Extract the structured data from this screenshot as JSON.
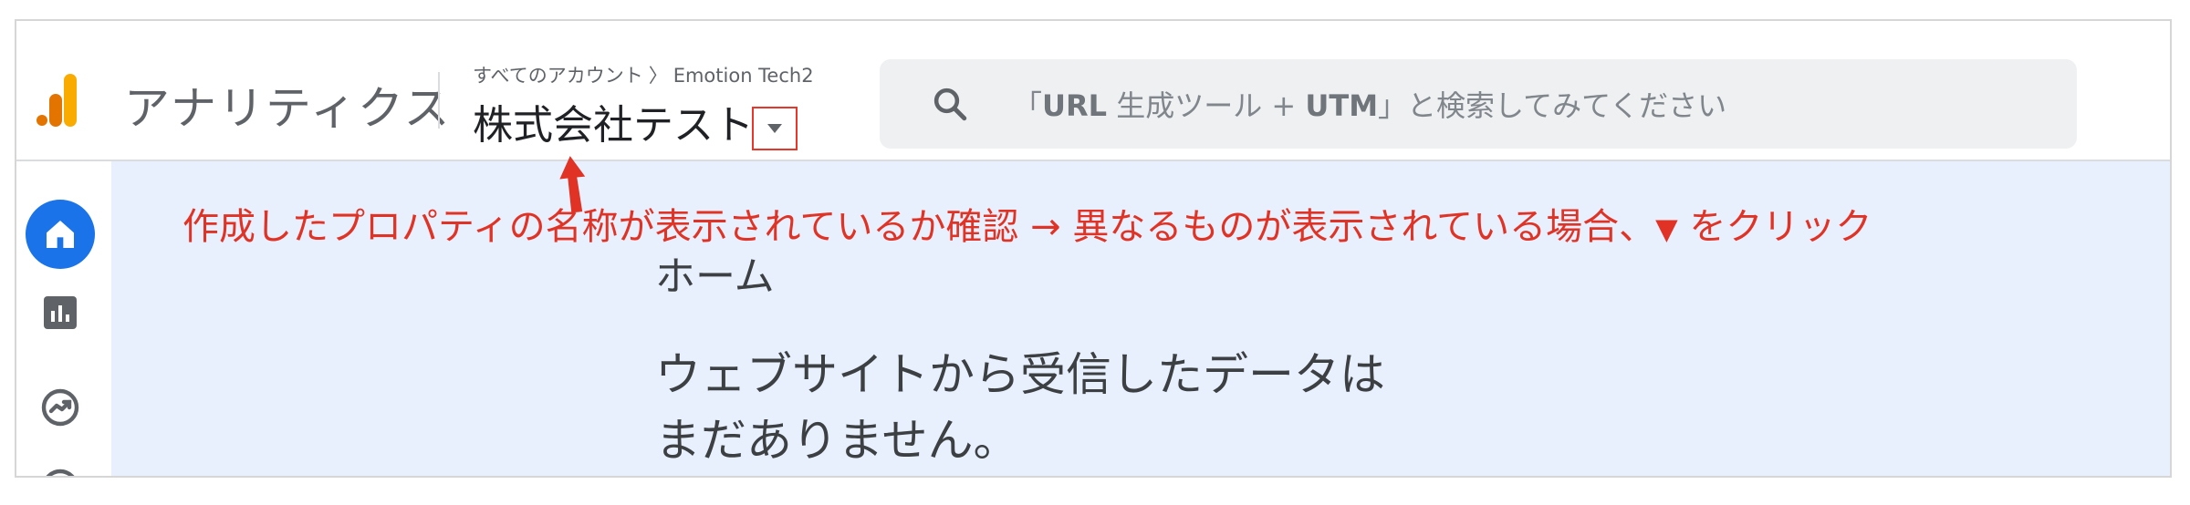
{
  "header": {
    "app_name": "アナリティクス",
    "breadcrumb": {
      "all_accounts": "すべてのアカウント",
      "separator": "〉",
      "account": "Emotion Tech2"
    },
    "property_name": "株式会社テスト",
    "search": {
      "prefix": "「",
      "query": "URL",
      "middle": " 生成ツール + ",
      "query2": "UTM",
      "suffix": "」と検索してみてください"
    }
  },
  "sidebar": {
    "items": [
      {
        "name": "home",
        "icon": "home-icon",
        "active": true
      },
      {
        "name": "reports",
        "icon": "bar-chart-icon",
        "active": false
      },
      {
        "name": "explore",
        "icon": "explore-icon",
        "active": false
      },
      {
        "name": "advertising",
        "icon": "target-icon",
        "active": false
      }
    ]
  },
  "annotation": {
    "text_before": "作成したプロパティの名称が表示されているか確認 → 異なるものが表示されている場合、",
    "triangle": "▼",
    "text_after": " をクリック"
  },
  "main": {
    "title": "ホーム",
    "empty_line1": "ウェブサイトから受信したデータは",
    "empty_line2": "まだありません。"
  },
  "colors": {
    "accent_blue": "#1a73e8",
    "annotation_red": "#e03325",
    "main_bg": "#e8f0fe",
    "logo_orange": "#f9ab00",
    "logo_dark_orange": "#e37400"
  }
}
